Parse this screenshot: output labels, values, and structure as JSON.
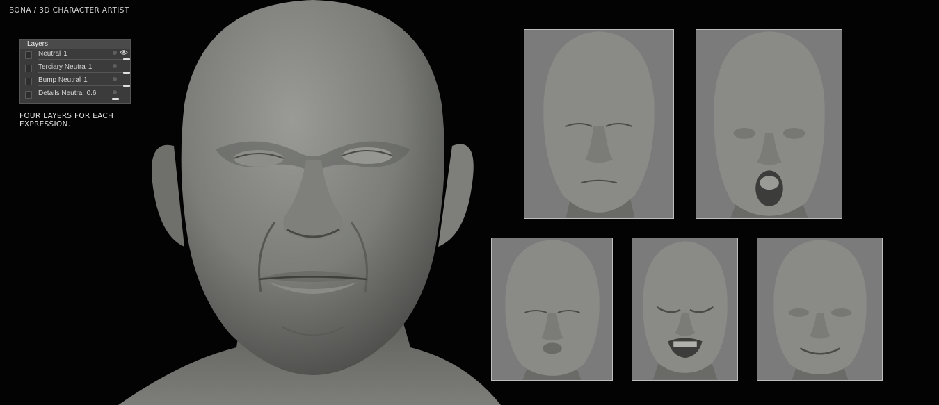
{
  "header": {
    "title": "BONA / 3D CHARACTER ARTIST"
  },
  "layers_panel": {
    "title": "Layers",
    "layers": [
      {
        "name": "Neutral",
        "value": "1",
        "slider": 1.0
      },
      {
        "name": "Terciary Neutra",
        "value": "1",
        "slider": 1.0
      },
      {
        "name": "Bump Neutral",
        "value": "1",
        "slider": 1.0
      },
      {
        "name": "Details Neutral",
        "value": "0.6",
        "slider": 0.6
      }
    ]
  },
  "caption": "FOUR LAYERS FOR EACH EXPRESSION.",
  "colors": {
    "background": "#030303",
    "clay": "#8a8b87",
    "thumb_bg": "#7b7b7b"
  },
  "thumbnails": [
    {
      "expression": "eyes-closed-neutral"
    },
    {
      "expression": "mouth-open-surprise"
    },
    {
      "expression": "lips-pursed"
    },
    {
      "expression": "snarl-teeth"
    },
    {
      "expression": "smile"
    }
  ]
}
